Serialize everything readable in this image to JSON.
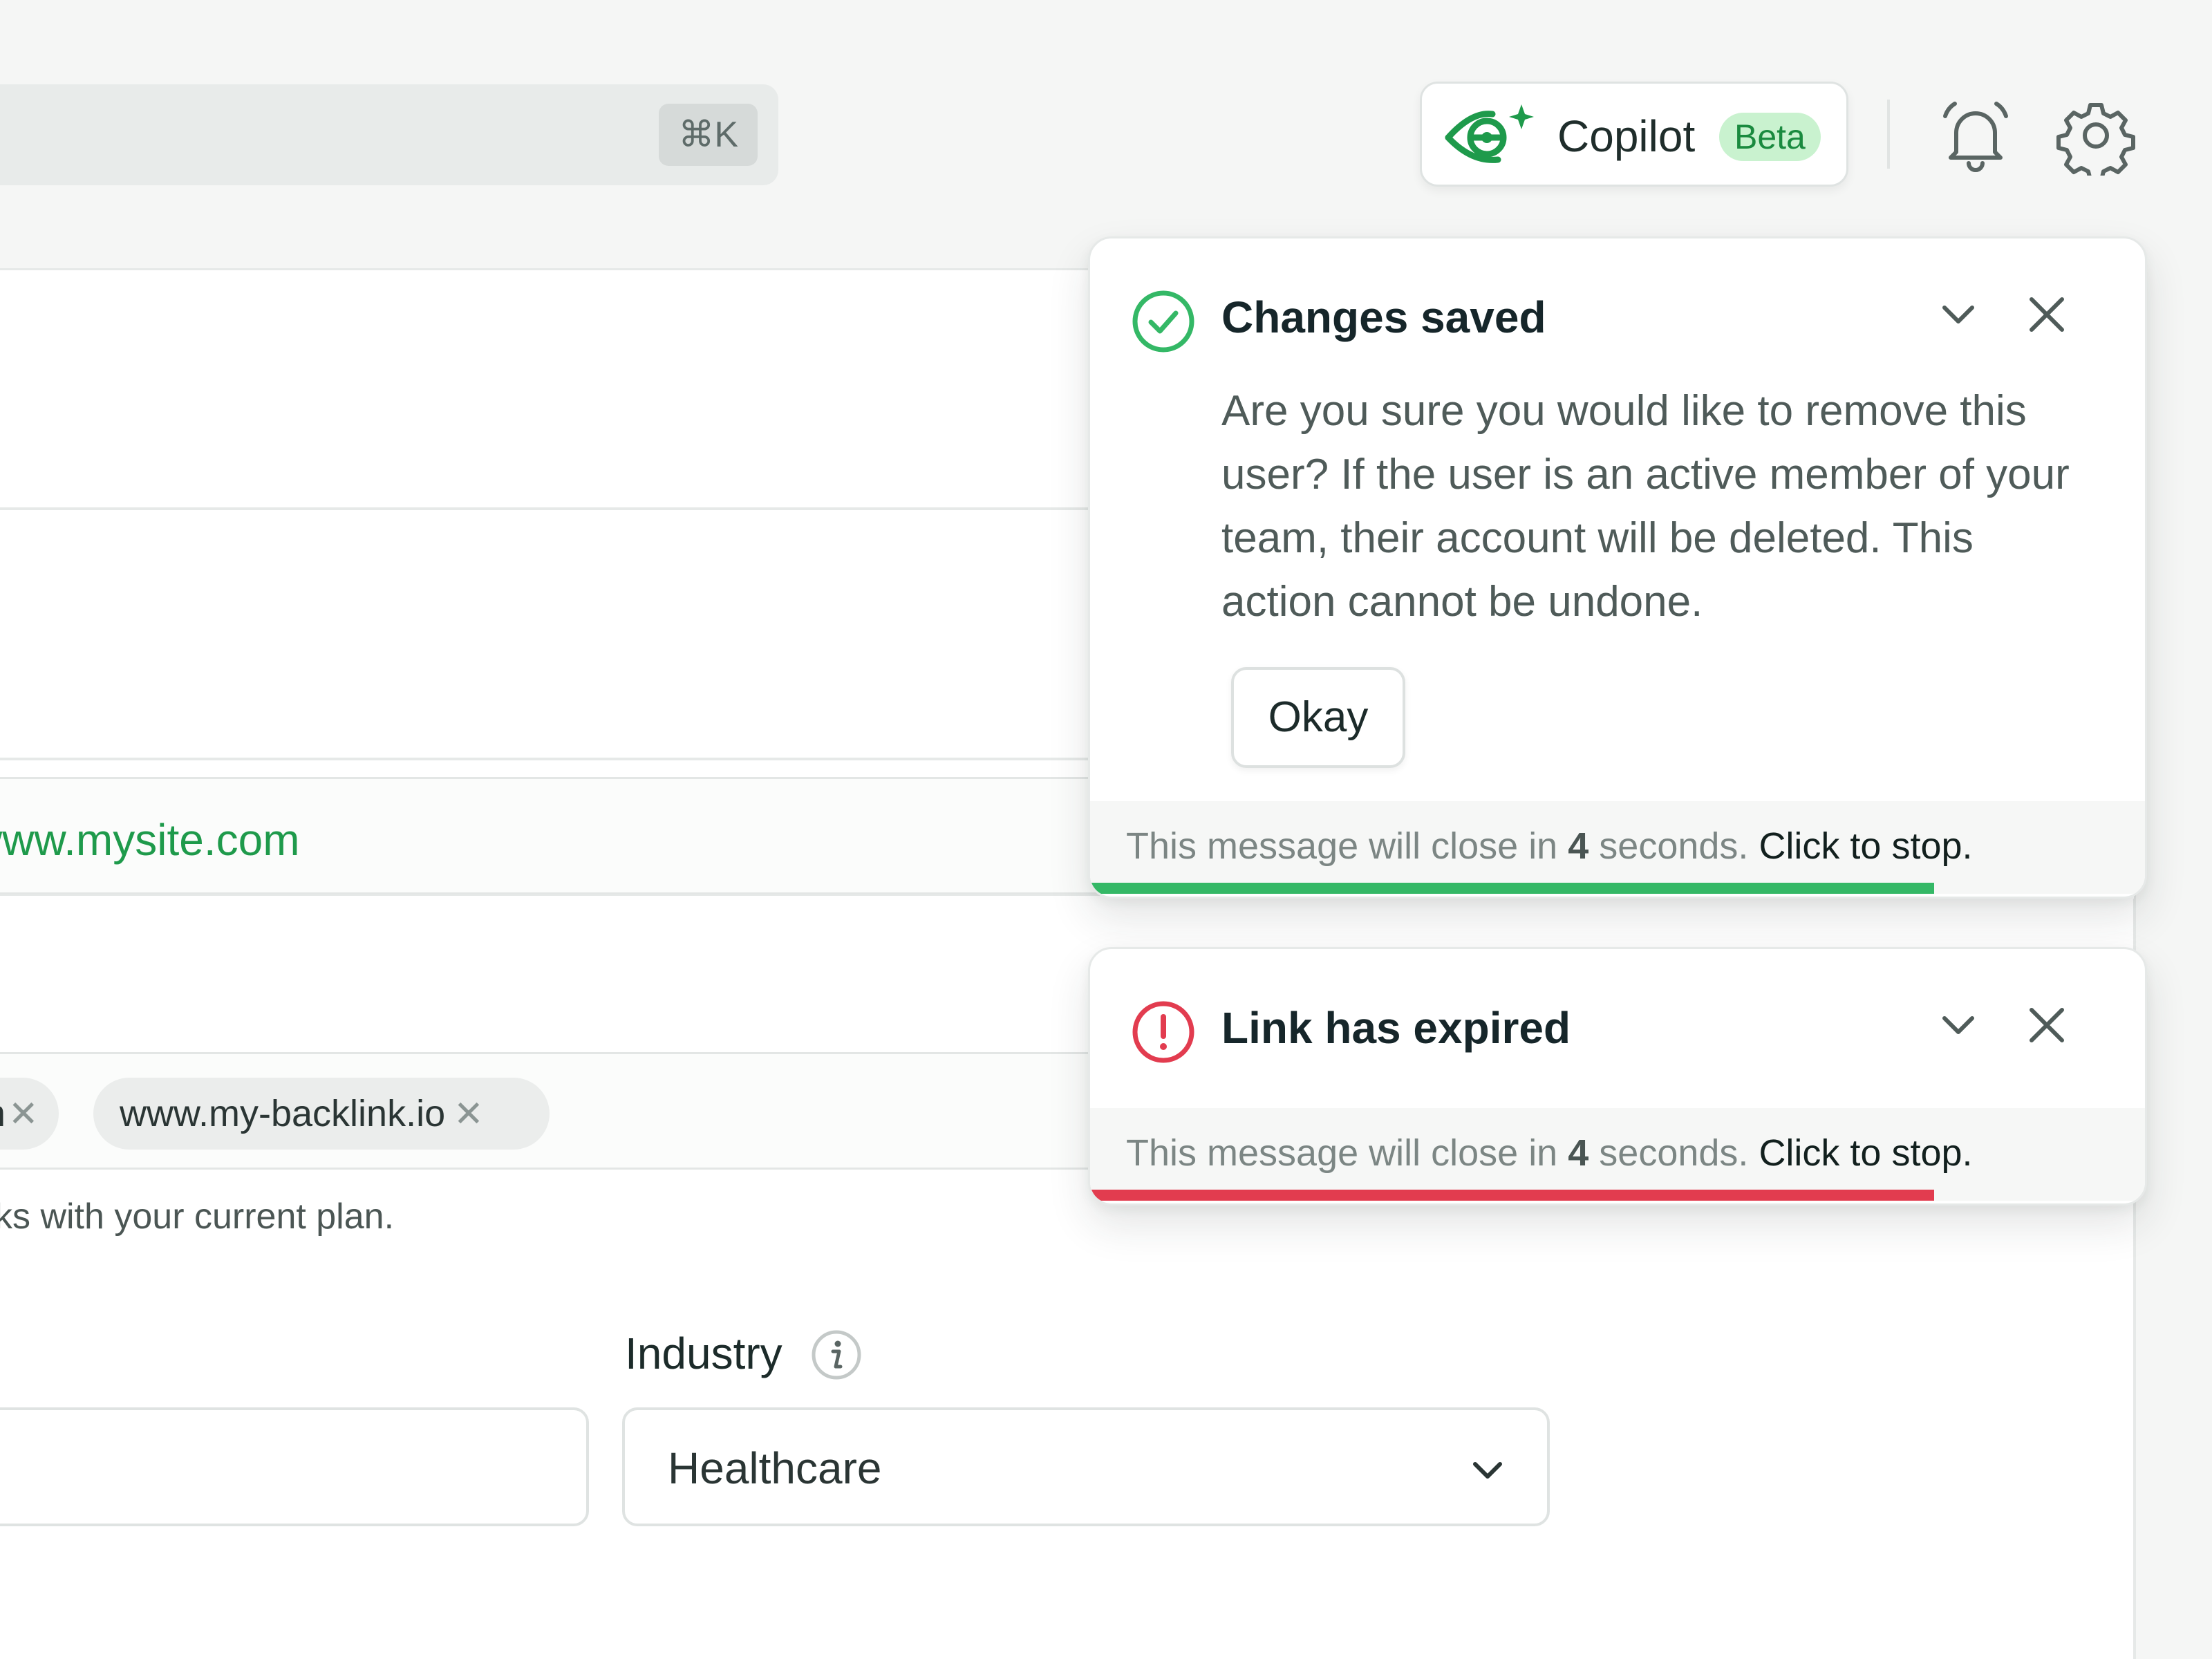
{
  "search": {
    "shortcut": "⌘K"
  },
  "header": {
    "copilot_label": "Copilot",
    "copilot_badge": "Beta",
    "bell_icon": "bell-icon",
    "settings_icon": "gear-icon",
    "brand_color": "#1e9a4b"
  },
  "form": {
    "website_value": "www.mysite.com",
    "backlinks": [
      {
        "label": "m"
      },
      {
        "label": "www.my-backlink.io"
      }
    ],
    "tag_remove_glyph": "✕",
    "backlinks_helper": "ks with your current plan.",
    "industry_label": "Industry",
    "industry_value": "Healthcare"
  },
  "toasts": [
    {
      "status": "success",
      "title": "Changes saved",
      "message": "Are you sure you would like to remove this user? If the user is an active member of your team, their account will be deleted. This action cannot be undone.",
      "action_label": "Okay",
      "footer_prefix": "This message will close in ",
      "seconds": "4",
      "footer_suffix": " seconds.",
      "stop_label": "Click to stop.",
      "progress": 0.8,
      "color": "#34b866"
    },
    {
      "status": "error",
      "title": "Link has expired",
      "footer_prefix": "This message will close in ",
      "seconds": "4",
      "footer_suffix": " seconds.",
      "stop_label": "Click to stop.",
      "progress": 0.8,
      "color": "#e23c4f"
    }
  ]
}
